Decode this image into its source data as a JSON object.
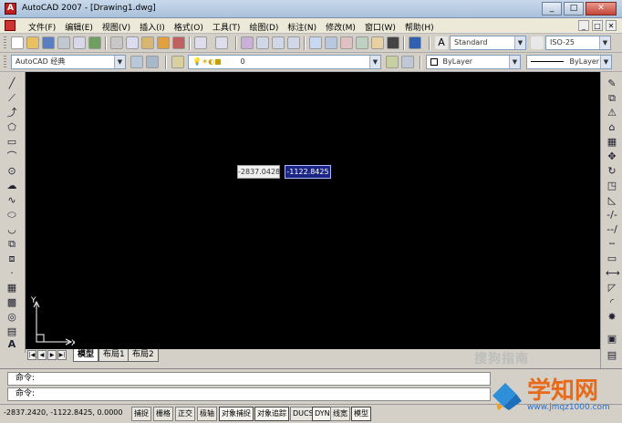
{
  "window": {
    "title": "AutoCAD 2007 - [Drawing1.dwg]",
    "minimize": "_",
    "maximize": "□",
    "close": "✕"
  },
  "menu": {
    "items": [
      "文件(F)",
      "编辑(E)",
      "视图(V)",
      "插入(I)",
      "格式(O)",
      "工具(T)",
      "绘图(D)",
      "标注(N)",
      "修改(M)",
      "窗口(W)",
      "帮助(H)"
    ],
    "doc_buttons": [
      "_",
      "□",
      "✕"
    ]
  },
  "toolbar": {
    "text_style": "Standard",
    "dim_style": "ISO-25",
    "workspace": "AutoCAD 经典",
    "layer": "0",
    "color": "ByLayer",
    "linetype": "ByLayer"
  },
  "canvas": {
    "background": "#000000",
    "dynamic_input_x": "-2837.0428",
    "dynamic_input_y": "-1122.8425",
    "ucs_x_label": "X",
    "ucs_y_label": "Y"
  },
  "layout_tabs": {
    "tabs": [
      "模型",
      "布局1",
      "布局2"
    ],
    "active": "模型"
  },
  "command": {
    "line1": "命令:",
    "line2": "命令:"
  },
  "status": {
    "coordinates": "-2837.2420, -1122.8425, 0.0000",
    "buttons": [
      "捕捉",
      "栅格",
      "正交",
      "极轴",
      "对象捕捉",
      "对象追踪",
      "DUCS",
      "DYN",
      "线宽",
      "模型"
    ]
  },
  "watermark": {
    "text": "搜狗指南"
  },
  "logo": {
    "name": "学知网",
    "url": "www.jmqz1000.com"
  }
}
